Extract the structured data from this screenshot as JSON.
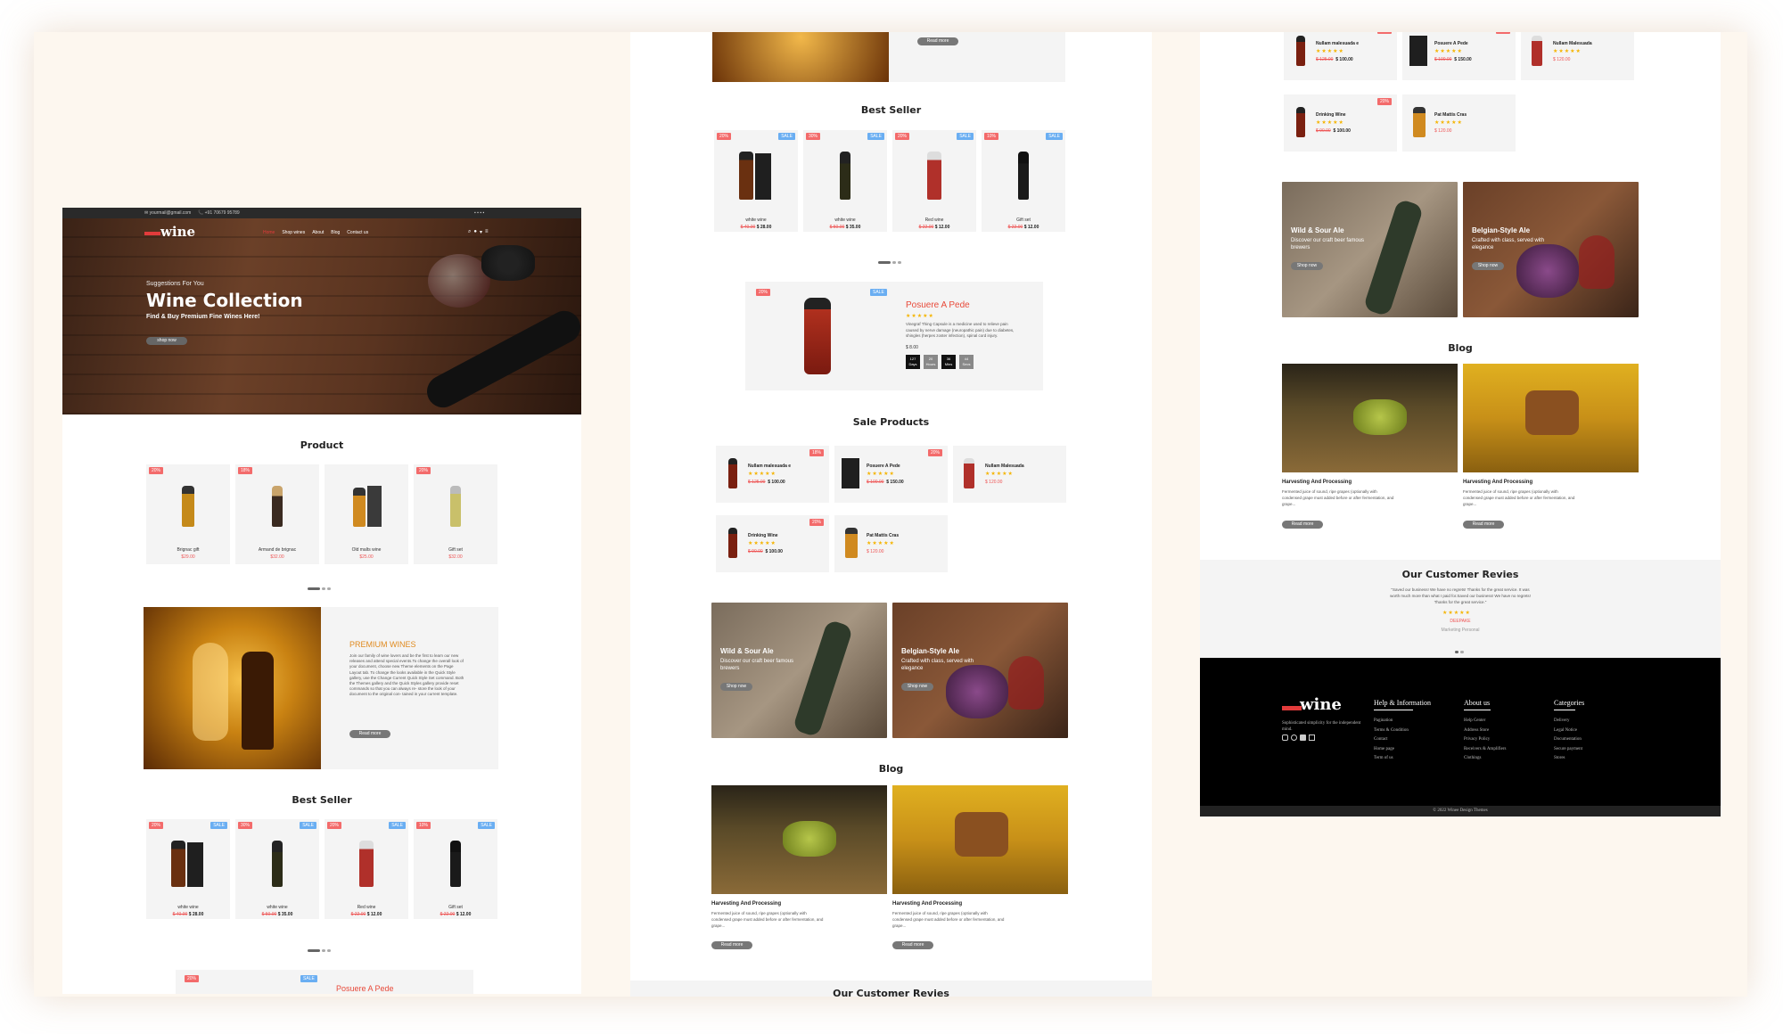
{
  "brand": {
    "logo_text": "wine",
    "accent": "#e23b3b"
  },
  "topbar": {
    "email": "✉ yourmail@gmail.com",
    "phone": "📞 +91 70679 95789"
  },
  "nav": {
    "items": [
      "Home",
      "Shop wines",
      "About",
      "Blog",
      "Contact us"
    ]
  },
  "hero": {
    "kicker": "Suggestions For You",
    "title": "Wine Collection",
    "subtitle": "Find & Buy Premium Fine Wines Here!",
    "button": "shop now"
  },
  "product_section": {
    "title": "Product",
    "items": [
      {
        "badge": "20%",
        "name": "Brignac gift",
        "price": "$29.00"
      },
      {
        "badge": "18%",
        "name": "Armand de brignac",
        "price": "$32.00"
      },
      {
        "badge": "",
        "name": "Old malts wine",
        "price": "$25.00"
      },
      {
        "badge": "20%",
        "name": "Gift set",
        "price": "$32.00"
      }
    ]
  },
  "premium": {
    "title": "PREMIUM WINES",
    "body": "Join our family of wine lovers and be the first to learn our new releases and attend special events.To change the overall look of your document, choose new Theme elements on the Page Layout tab. To change the looks available in the Quick Style gallery, use the Change Current Quick Style Set command. Both the Themes gallery and the Quick Styles gallery provide reset commands so that you can always re- store the look of your document to the original con- tained in your current template.",
    "button": "Read more"
  },
  "best_seller": {
    "title": "Best Seller",
    "items": [
      {
        "badge": "20%",
        "badge2": "SALE",
        "name": "white wine",
        "old": "$ 40.00",
        "price": "$ 28.00"
      },
      {
        "badge": "30%",
        "badge2": "SALE",
        "name": "white wine",
        "old": "$ 50.00",
        "price": "$ 35.00"
      },
      {
        "badge": "20%",
        "badge2": "SALE",
        "name": "Red wine",
        "old": "$ 22.00",
        "price": "$ 12.00"
      },
      {
        "badge": "10%",
        "badge2": "SALE",
        "name": "Gift set",
        "old": "$ 22.00",
        "price": "$ 12.00"
      }
    ]
  },
  "deal": {
    "badge": "20%",
    "badge2": "SALE",
    "title": "Posuere A Pede",
    "stars": "★★★★★",
    "desc": "Vinegraf Thing Capsule is a medicine used to relieve pain caused by nerve damage (neuropathic pain) due to diabetes, shingles (herpes zoster infection), spinal cord injury.",
    "price": "$ 8.00",
    "countdown": [
      {
        "v": "127",
        "l": "Days"
      },
      {
        "v": "20",
        "l": "Hours"
      },
      {
        "v": "36",
        "l": "Mins"
      },
      {
        "v": "44",
        "l": "Secs"
      }
    ]
  },
  "sale_products": {
    "title": "Sale Products",
    "items": [
      {
        "badge": "18%",
        "name": "Nullam malesuada e",
        "stars": "★★★★★",
        "old": "$ 125.00",
        "price": "$ 100.00"
      },
      {
        "badge": "20%",
        "name": "Posuere A Pede",
        "stars": "★★★★★",
        "old": "$ 100.00",
        "price": "$ 150.00"
      },
      {
        "badge": "",
        "name": "Nullam Malesuada",
        "stars": "★★★★★",
        "old": "",
        "price": "$ 120.00"
      },
      {
        "badge": "20%",
        "name": "Drinking Wine",
        "stars": "★★★★★",
        "old": "$ 90.00",
        "price": "$ 100.00"
      },
      {
        "badge": "",
        "name": "Pat Mattis Cras",
        "stars": "★★★★★",
        "old": "",
        "price": "$ 120.00"
      }
    ]
  },
  "banners": [
    {
      "title": "Wild & Sour Ale",
      "text": "Discover our craft beer famous brewers",
      "button": "Shop now"
    },
    {
      "title": "Belgian-Style Ale",
      "text": "Crafted with class, served with elegance",
      "button": "Shop now"
    }
  ],
  "blog": {
    "title": "Blog",
    "items": [
      {
        "title": "Harvesting And Processing",
        "text": "Fermented juice of sound, ripe grapes (optionally with condensed grape must added before or after fermentation, and grape...",
        "button": "Read more"
      },
      {
        "title": "Harvesting And Processing",
        "text": "Fermented juice of sound, ripe grapes (optionally with condensed grape must added before or after fermentation, and grape...",
        "button": "Read more"
      }
    ]
  },
  "reviews": {
    "title": "Our Customer Revies",
    "quote": "\"Saved our business! We have no regrets! Thanks for the great service. It was worth much more than what I paid for.Saved our business! We have no regrets! Thanks for the great service.\"",
    "stars": "★★★★★",
    "name": "DEEPAKE",
    "role": "Marketing Personal"
  },
  "footer": {
    "tagline": "Sophisticated simplicity for the independent mind.",
    "cols": [
      {
        "title": "Help & Information",
        "links": [
          "Pagination",
          "Terms & Condition",
          "Contact",
          "Home page",
          "Term of us"
        ]
      },
      {
        "title": "About us",
        "links": [
          "Help Center",
          "Address Store",
          "Privacy Policy",
          "Receivers & Amplifiers",
          "Clothings"
        ]
      },
      {
        "title": "Categories",
        "links": [
          "Delivery",
          "Legal Notice",
          "Documentation",
          "Secure payment",
          "Stores"
        ]
      }
    ],
    "copyright": "© 2022 Winee Design Themes"
  }
}
